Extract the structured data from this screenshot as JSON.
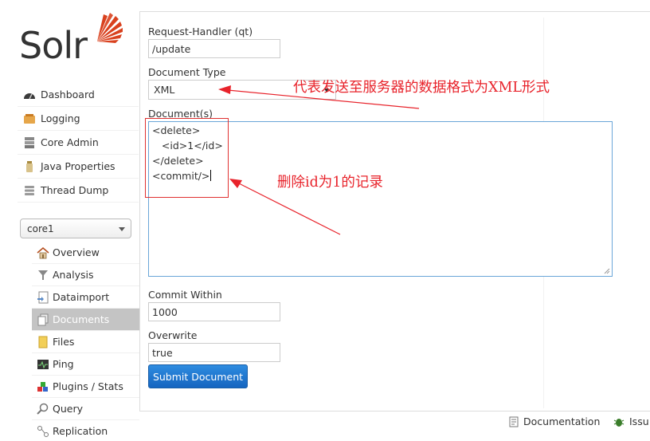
{
  "app": {
    "logo_text": "Solr",
    "brand_color": "#d9411e"
  },
  "nav": {
    "items": [
      {
        "label": "Dashboard",
        "icon": "dashboard-icon"
      },
      {
        "label": "Logging",
        "icon": "logging-icon"
      },
      {
        "label": "Core Admin",
        "icon": "core-admin-icon"
      },
      {
        "label": "Java Properties",
        "icon": "java-icon"
      },
      {
        "label": "Thread Dump",
        "icon": "thread-dump-icon"
      }
    ]
  },
  "core_selector": {
    "value": "core1"
  },
  "core_menu": {
    "items": [
      {
        "label": "Overview",
        "icon": "home-icon"
      },
      {
        "label": "Analysis",
        "icon": "funnel-icon"
      },
      {
        "label": "Dataimport",
        "icon": "dataimport-icon"
      },
      {
        "label": "Documents",
        "icon": "documents-icon",
        "active": true
      },
      {
        "label": "Files",
        "icon": "folder-icon"
      },
      {
        "label": "Ping",
        "icon": "ping-icon"
      },
      {
        "label": "Plugins / Stats",
        "icon": "plugins-icon"
      },
      {
        "label": "Query",
        "icon": "query-icon"
      },
      {
        "label": "Replication",
        "icon": "replication-icon"
      }
    ]
  },
  "form": {
    "request_handler_label": "Request-Handler (qt)",
    "request_handler_value": "/update",
    "document_type_label": "Document Type",
    "document_type_value": "XML",
    "documents_label": "Document(s)",
    "documents_lines": [
      "<delete>",
      "   <id>1</id>",
      "</delete>",
      "<commit/>"
    ],
    "commit_within_label": "Commit Within",
    "commit_within_value": "1000",
    "overwrite_label": "Overwrite",
    "overwrite_value": "true",
    "submit_label": "Submit Document"
  },
  "annotations": {
    "doc_type_note": "代表发送至服务器的数据格式为XML形式",
    "delete_note": "删除id为1的记录",
    "color": "#e8232b"
  },
  "footer": {
    "documentation_label": "Documentation",
    "issues_label": "Issu"
  }
}
